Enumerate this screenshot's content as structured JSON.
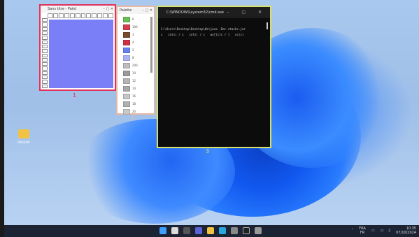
{
  "window1": {
    "title": "Sans titre - Paint",
    "buttons": "– ▢ ✕",
    "label": "1"
  },
  "window2": {
    "title": "Palette",
    "buttons": "– ▢ ✕",
    "label": "2",
    "items": [
      {
        "color": "#6bbf59",
        "text": "0"
      },
      {
        "color": "#d43d4e",
        "text": "100"
      },
      {
        "color": "#7a4b2c",
        "text": "3"
      },
      {
        "color": "#cf2f45",
        "text": "4"
      },
      {
        "color": "#6680f0",
        "text": "2"
      },
      {
        "color": "#aab4f5",
        "text": "8"
      },
      {
        "color": "#bdbdbd",
        "text": "200"
      },
      {
        "color": "#9a9a9a",
        "text": "10"
      },
      {
        "color": "#b5b5b5",
        "text": "12"
      },
      {
        "color": "#a8a8a8",
        "text": "14"
      },
      {
        "color": "#c5c5c5",
        "text": "16"
      },
      {
        "color": "#b0b0b0",
        "text": "18"
      },
      {
        "color": "#c8c8c8",
        "text": "20"
      }
    ]
  },
  "window3": {
    "title": "C:\\WINDOWS\\system32\\cmd.exe",
    "buttons": "– ▢ ✕",
    "label": "3",
    "line1": "C:\\Users\\Desktop\\Desktop\\Ws\\java -Dar.stachc.jar",
    "line2": "c   cols) / c   cols) / c   wx[lclc / ]   vc)c)"
  },
  "desktop": {
    "folder_label": "dossier"
  },
  "taskbar": {
    "lang": "FRA",
    "lang2": "FR",
    "time": "10:35",
    "date": "07/10/2024"
  }
}
